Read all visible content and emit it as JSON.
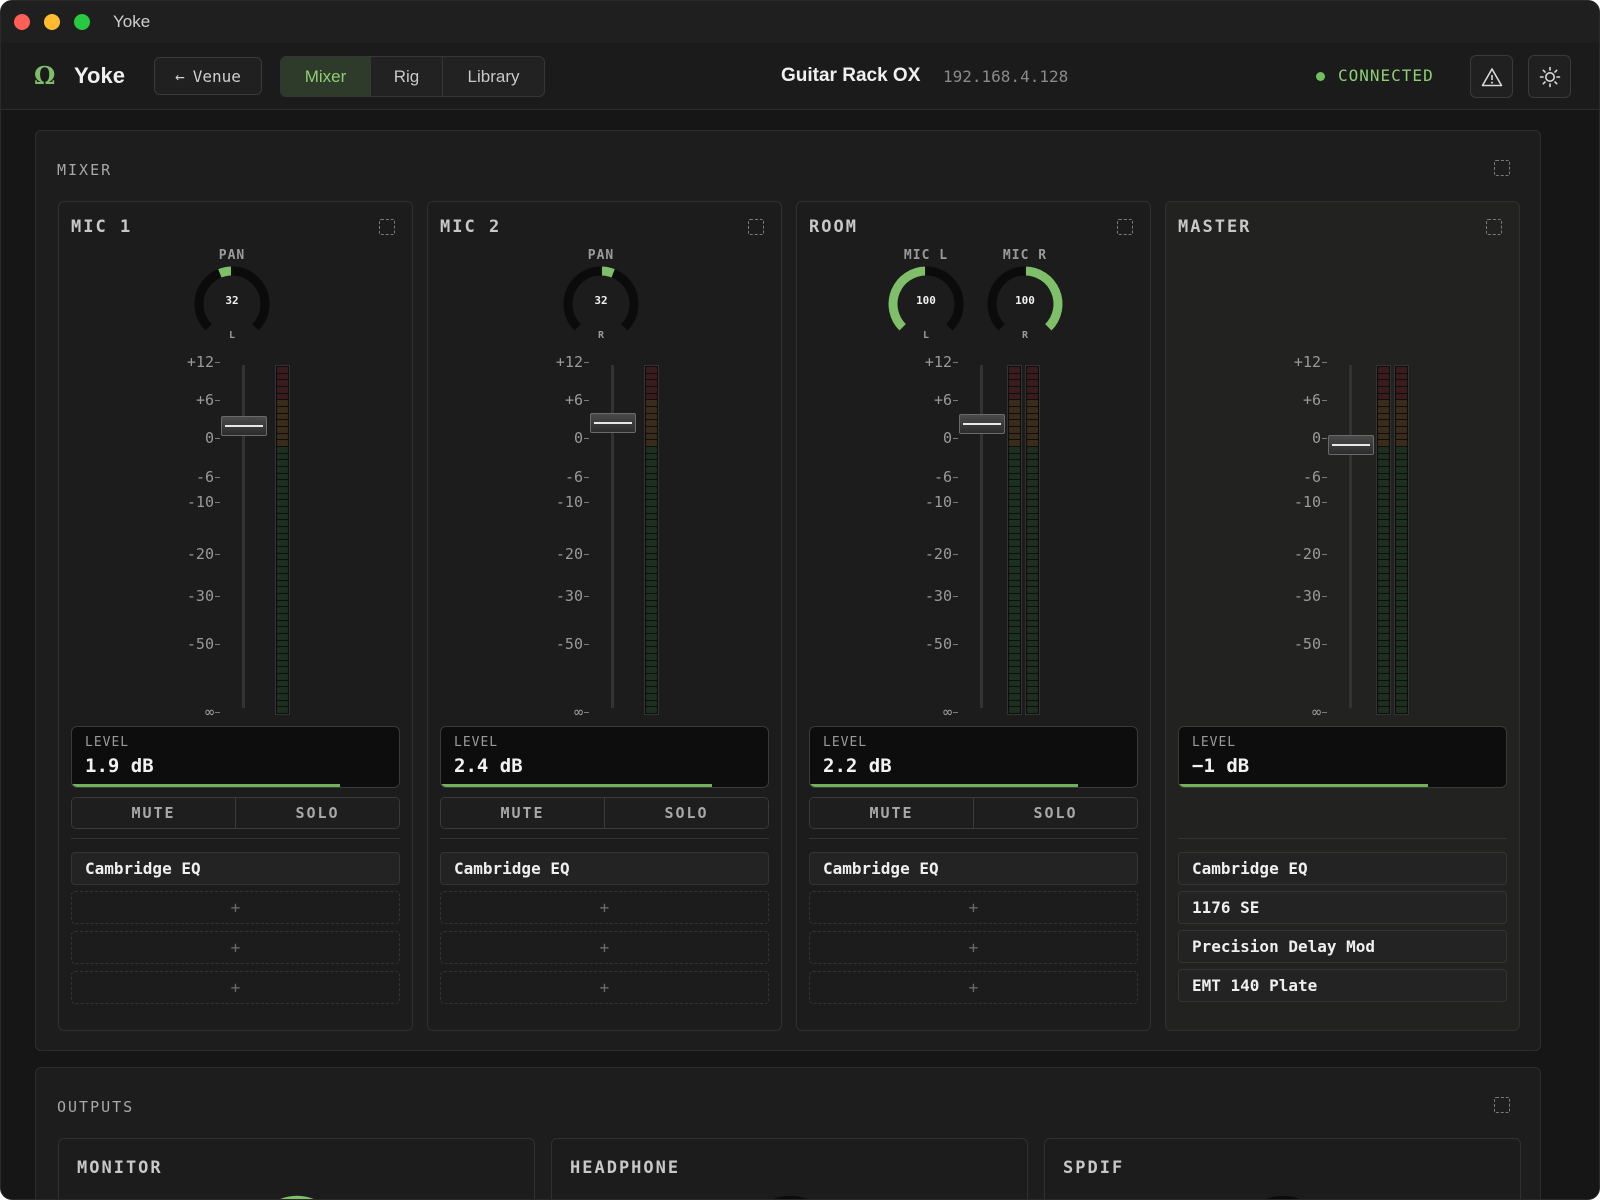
{
  "window": {
    "title": "Yoke"
  },
  "app": {
    "name": "Yoke",
    "logo_glyph": "Ω",
    "back_label": "Venue",
    "back_icon": "arrow-left-icon"
  },
  "tabs": [
    {
      "label": "Mixer",
      "active": true
    },
    {
      "label": "Rig",
      "active": false
    },
    {
      "label": "Library",
      "active": false
    }
  ],
  "device": {
    "name": "Guitar Rack OX",
    "ip": "192.168.4.128"
  },
  "status": {
    "text": "CONNECTED",
    "color": "#6fbf5e"
  },
  "accent": "#7fbf6a",
  "mixer": {
    "title": "MIXER",
    "scale_ticks": [
      "+12",
      "+6",
      "0",
      "-6",
      "-10",
      "-20",
      "-30",
      "-50",
      "∞"
    ],
    "strips": [
      {
        "name": "MIC 1",
        "knobs": [
          {
            "label": "PAN",
            "value": "32",
            "sub": "L",
            "fraction": 0.16,
            "side": "left"
          }
        ],
        "level_label": "LEVEL",
        "level_text": "1.9 dB",
        "level_fraction": 0.82,
        "mute": "MUTE",
        "solo": "SOLO",
        "plugins": [
          "Cambridge EQ"
        ],
        "empty_slots": 3
      },
      {
        "name": "MIC 2",
        "knobs": [
          {
            "label": "PAN",
            "value": "32",
            "sub": "R",
            "fraction": 0.16,
            "side": "right"
          }
        ],
        "level_label": "LEVEL",
        "level_text": "2.4 dB",
        "level_fraction": 0.83,
        "mute": "MUTE",
        "solo": "SOLO",
        "plugins": [
          "Cambridge EQ"
        ],
        "empty_slots": 3
      },
      {
        "name": "ROOM",
        "knobs": [
          {
            "label": "MIC L",
            "value": "100",
            "sub": "L",
            "fraction": 1.0,
            "side": "left"
          },
          {
            "label": "MIC R",
            "value": "100",
            "sub": "R",
            "fraction": 1.0,
            "side": "right"
          }
        ],
        "level_label": "LEVEL",
        "level_text": "2.2 dB",
        "level_fraction": 0.82,
        "mute": "MUTE",
        "solo": "SOLO",
        "plugins": [
          "Cambridge EQ"
        ],
        "empty_slots": 3
      },
      {
        "name": "MASTER",
        "knobs": [],
        "level_label": "LEVEL",
        "level_text": "−1 dB",
        "level_fraction": 0.76,
        "mute": null,
        "solo": null,
        "plugins": [
          "Cambridge EQ",
          "1176 SE",
          "Precision Delay Mod",
          "EMT 140 Plate"
        ],
        "empty_slots": 0
      }
    ]
  },
  "outputs": {
    "title": "OUTPUTS",
    "cards": [
      {
        "name": "MONITOR"
      },
      {
        "name": "HEADPHONE"
      },
      {
        "name": "SPDIF"
      }
    ]
  }
}
